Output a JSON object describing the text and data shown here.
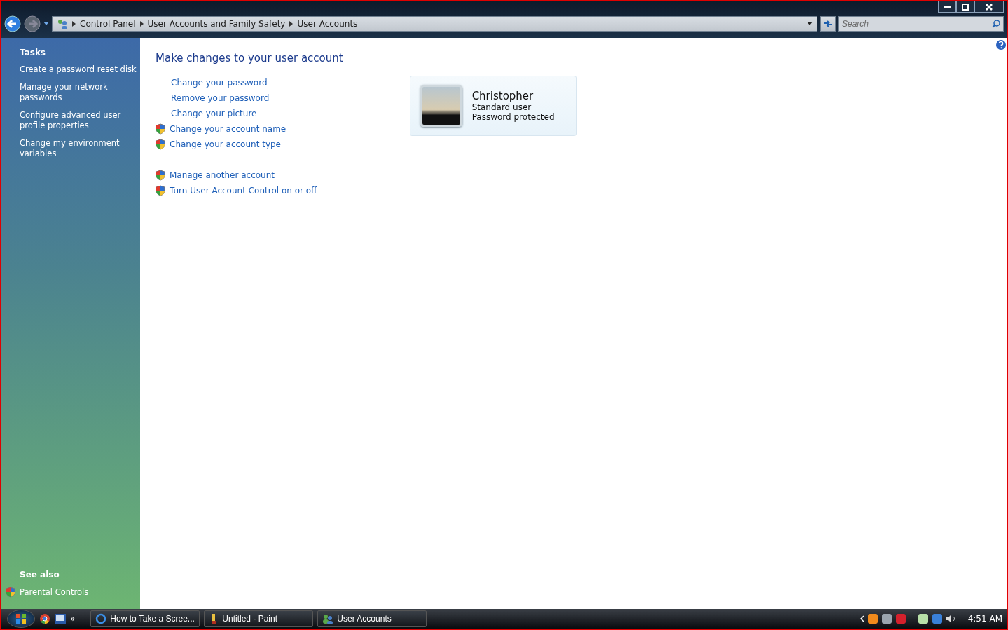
{
  "address_bar": {
    "breadcrumbs": [
      "Control Panel",
      "User Accounts and Family Safety",
      "User Accounts"
    ]
  },
  "search": {
    "placeholder": "Search"
  },
  "sidebar": {
    "title": "Tasks",
    "items": [
      "Create a password reset disk",
      "Manage your network passwords",
      "Configure advanced user profile properties",
      "Change my environment variables"
    ],
    "see_also": {
      "title": "See also",
      "items": [
        {
          "label": "Parental Controls",
          "kind": "shield"
        }
      ]
    }
  },
  "main": {
    "heading": "Make changes to your user account",
    "link_groups": [
      [
        {
          "label": "Change your password",
          "kind": "plain"
        },
        {
          "label": "Remove your password",
          "kind": "plain"
        },
        {
          "label": "Change your picture",
          "kind": "plain"
        },
        {
          "label": "Change your account name",
          "kind": "shield"
        },
        {
          "label": "Change your account type",
          "kind": "shield"
        }
      ],
      [
        {
          "label": "Manage another account",
          "kind": "shield"
        },
        {
          "label": "Turn User Account Control on or off",
          "kind": "shield"
        }
      ]
    ],
    "account": {
      "name": "Christopher",
      "type": "Standard user",
      "status": "Password protected"
    }
  },
  "taskbar": {
    "quick_launch_more": "»",
    "tasks": [
      {
        "label": "How to Take a Scree...",
        "kind": "browser"
      },
      {
        "label": "Untitled - Paint",
        "kind": "paint"
      },
      {
        "label": "User Accounts",
        "kind": "users"
      }
    ],
    "clock": "4:51 AM"
  }
}
